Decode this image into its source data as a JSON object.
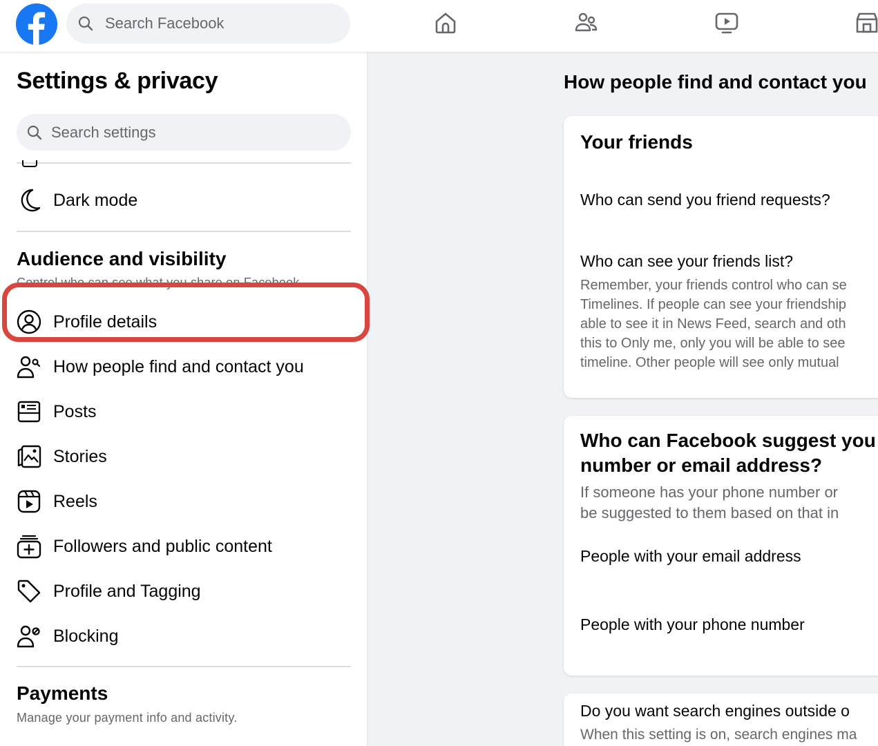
{
  "topbar": {
    "search_placeholder": "Search Facebook",
    "nav": [
      "home-icon",
      "friends-icon",
      "watch-icon",
      "marketplace-icon"
    ]
  },
  "sidebar": {
    "title": "Settings & privacy",
    "search_placeholder": "Search settings",
    "dark_mode": "Dark mode",
    "audience": {
      "heading": "Audience and visibility",
      "subtitle": "Control who can see what you share on Facebook.",
      "items": [
        {
          "label": "Profile details",
          "icon": "profile-circle-icon"
        },
        {
          "label": "How people find and contact you",
          "icon": "person-search-icon",
          "selected": true
        },
        {
          "label": "Posts",
          "icon": "posts-icon"
        },
        {
          "label": "Stories",
          "icon": "stories-icon"
        },
        {
          "label": "Reels",
          "icon": "reels-icon"
        },
        {
          "label": "Followers and public content",
          "icon": "followers-icon"
        },
        {
          "label": "Profile and Tagging",
          "icon": "tag-icon"
        },
        {
          "label": "Blocking",
          "icon": "blocking-icon"
        }
      ]
    },
    "payments": {
      "heading": "Payments",
      "subtitle": "Manage your payment info and activity."
    }
  },
  "content": {
    "title": "How people find and contact you",
    "card1": {
      "heading": "Your friends",
      "q1": "Who can send you friend requests?",
      "q2": "Who can see your friends list?",
      "desc": "Remember, your friends control who can se\nTimelines. If people can see your friendship\nable to see it in News Feed, search and oth\nthis to Only me, only you will be able to see\ntimeline. Other people will see only mutual"
    },
    "card2": {
      "heading_line1": "Who can Facebook suggest you",
      "heading_line2": "number or email address?",
      "desc": "If someone has your phone number or\nbe suggested to them based on that in",
      "opt1": "People with your email address",
      "opt2": "People with your phone number"
    },
    "card3": {
      "q": "Do you want search engines outside o",
      "desc": "When this setting is on, search engines ma"
    }
  },
  "colors": {
    "brand": "#1877f2",
    "highlight": "#d9453f",
    "secondary_text": "#65676b"
  }
}
